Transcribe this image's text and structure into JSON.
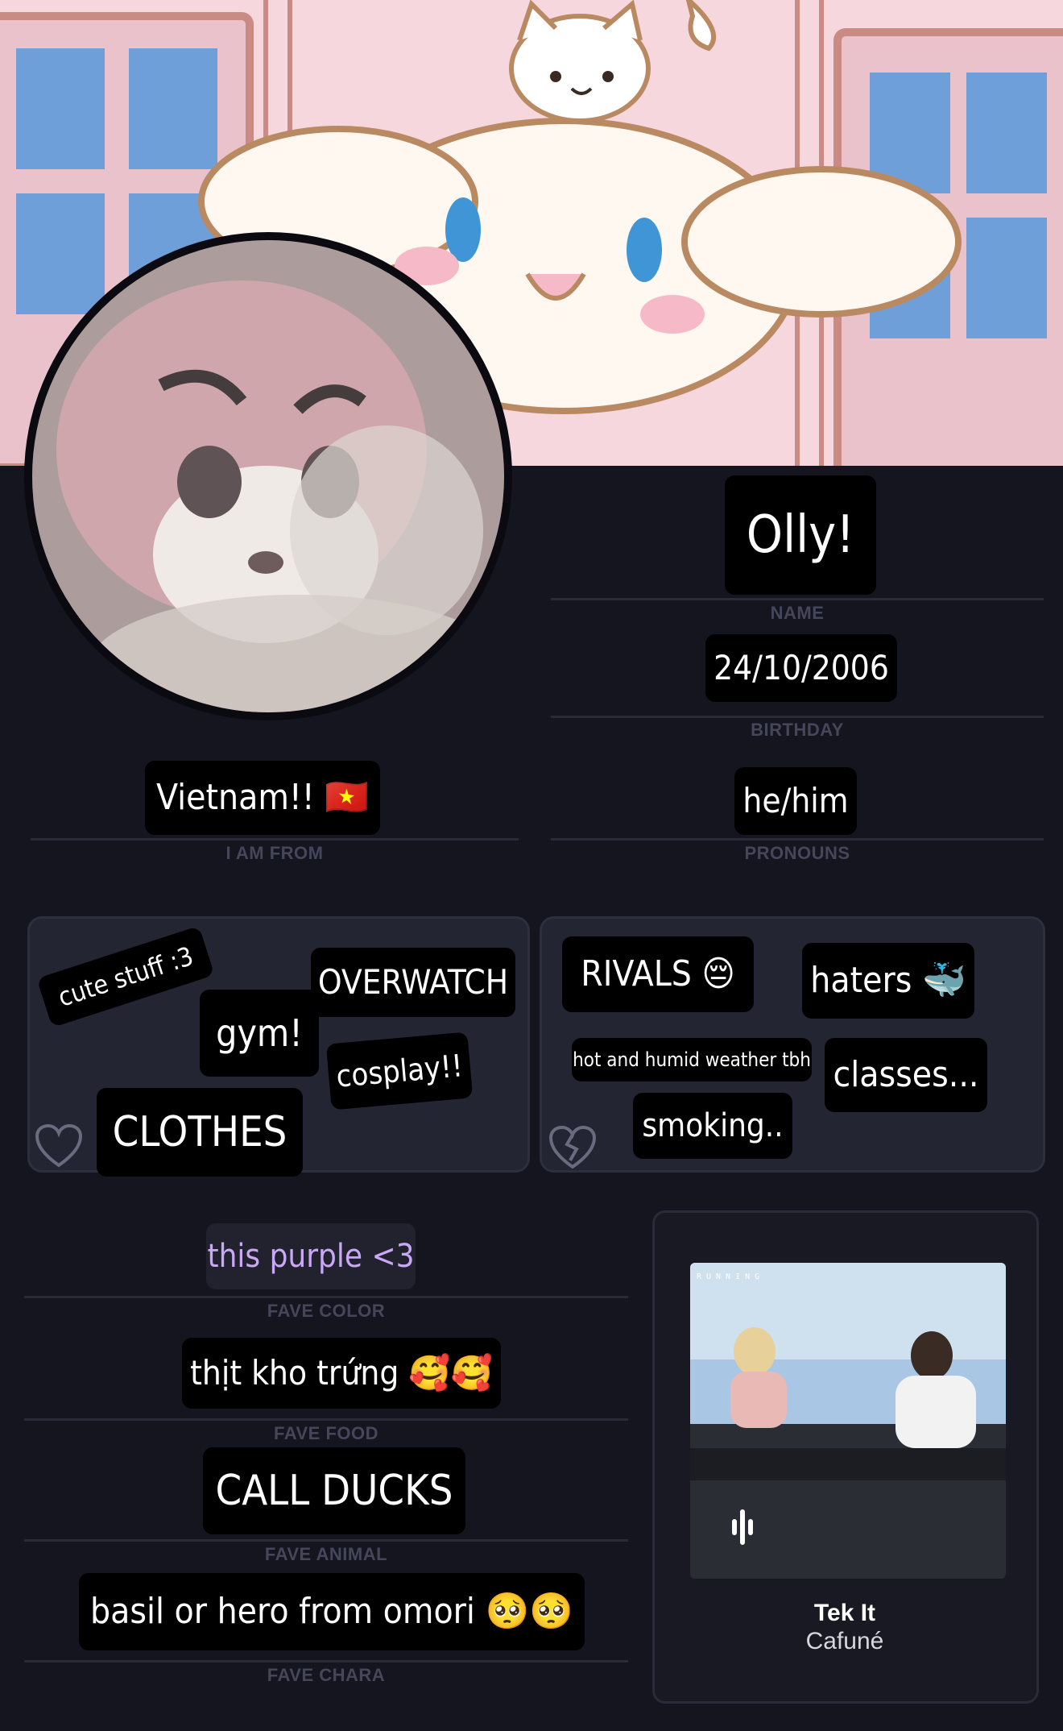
{
  "profile": {
    "name": "Olly!",
    "name_caption": "NAME",
    "birthday": "24/10/2006",
    "birthday_caption": "BIRTHDAY",
    "from": "Vietnam!! 🇻🇳",
    "from_caption": "I AM FROM",
    "pronouns": "he/him",
    "pronouns_caption": "PRONOUNS"
  },
  "likes": {
    "icon": "heart-outline-icon",
    "items": [
      "cute stuff :3",
      "OVERWATCH",
      "gym!",
      "cosplay!!",
      "CLOTHES"
    ]
  },
  "dislikes": {
    "icon": "broken-heart-icon",
    "items": [
      "RIVALS 😔",
      "haters 🐳",
      "hot and humid weather tbh",
      "classes...",
      "smoking.."
    ]
  },
  "faves": {
    "color": "this purple <3",
    "color_caption": "FAVE COLOR",
    "food": "thịt kho trứng 🥰🥰",
    "food_caption": "FAVE FOOD",
    "animal": "CALL DUCKS",
    "animal_caption": "FAVE ANIMAL",
    "chara": "basil or hero from omori 🥺🥺",
    "chara_caption": "FAVE CHARA"
  },
  "music": {
    "album_header": "RUNNING",
    "title": "Tek It",
    "artist": "Cafuné",
    "play_icon": "audio-wave-icon"
  },
  "colors": {
    "background": "#151520",
    "card": "#242533",
    "accent_purple": "#c9a8f5"
  }
}
